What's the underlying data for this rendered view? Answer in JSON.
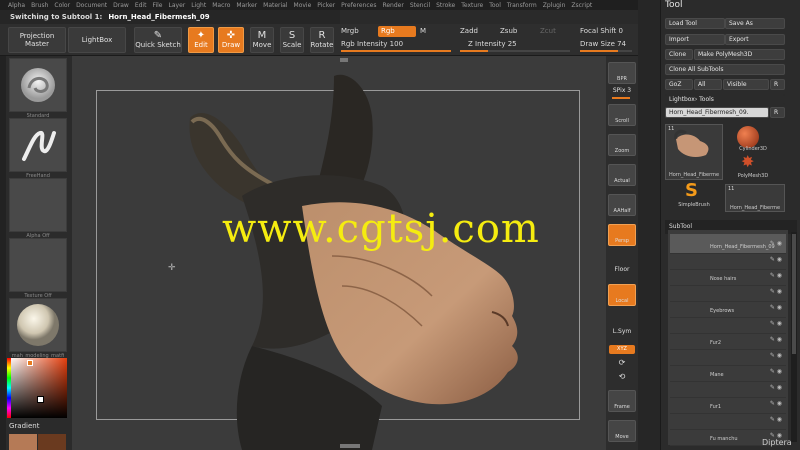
{
  "menu": [
    "Alpha",
    "Brush",
    "Color",
    "Document",
    "Draw",
    "Edit",
    "File",
    "Layer",
    "Light",
    "Macro",
    "Marker",
    "Material",
    "Movie",
    "Picker",
    "Preferences",
    "Render",
    "Stencil",
    "Stroke",
    "Texture",
    "Tool",
    "Transform",
    "Zplugin",
    "Zscript"
  ],
  "status": {
    "prefix": "Switching to Subtool 1:",
    "subtool": "Horn_Head_Fibermesh_09"
  },
  "toolbar": {
    "projection_master": "Projection Master",
    "lightbox": "LightBox",
    "quick_sketch": "Quick Sketch",
    "edit": "Edit",
    "draw": "Draw",
    "move": "Move",
    "scale": "Scale",
    "rotate": "Rotate",
    "mrgb": "Mrgb",
    "rgb": "Rgb",
    "m": "M",
    "rgb_intensity": "Rgb Intensity 100",
    "zadd": "Zadd",
    "zsub": "Zsub",
    "zcut": "Zcut",
    "z_intensity": "Z Intensity 25",
    "focal_shift": "Focal Shift 0",
    "draw_size": "Draw Size 74",
    "rgb_intensity_value": 100,
    "z_intensity_value": 25,
    "draw_size_value": 74,
    "accent": "#e77a1f"
  },
  "left_shelf": {
    "brush": "Standard",
    "stroke": "FreeHand",
    "alpha": "Alpha Off",
    "texture": "Texture Off",
    "material": "mah_modeling_matfi",
    "gradient": "Gradient"
  },
  "viewport": {
    "watermark": "www.cgtsj.com"
  },
  "right_shelf": {
    "bpr": "BPR",
    "spix": "SPix 3",
    "scroll": "Scroll",
    "zoom": "Zoom",
    "actual": "Actual",
    "aahalf": "AAHalf",
    "persp": "Persp",
    "floor": "Floor",
    "local": "Local",
    "lsym": "L.Sym",
    "xyz": "XYZ",
    "frame": "Frame",
    "move": "Move"
  },
  "tool_panel": {
    "title": "Tool",
    "load_tool": "Load Tool",
    "save_as": "Save As",
    "import": "Import",
    "export": "Export",
    "clone": "Clone",
    "make_polymesh": "Make PolyMesh3D",
    "clone_all": "Clone All SubTools",
    "goz": "GoZ",
    "all": "All",
    "visible": "Visible",
    "r": "R",
    "lightbox_tools": "Lightbox› Tools",
    "current_tool": "Horn_Head_Fibermesh_09.",
    "r2": "R",
    "count_badge": "11",
    "thumb_main": "Horn_Head_Fiberme",
    "cylinder": "Cylinder3D",
    "polymesh": "PolyMesh3D",
    "simplebrush": "SimpleBrush",
    "thumb_small_badge": "11",
    "thumb_small": "Horn_Head_Fiberme",
    "subtool_header": "SubTool",
    "subtools": [
      "Horn_Head_Fibermesh_09",
      "",
      "Nose hairs",
      "",
      "Eyebrows",
      "",
      "Fur2",
      "",
      "Mane",
      "",
      "Fur1",
      "",
      "Fu manchu"
    ]
  },
  "corner_text": "Diptera"
}
